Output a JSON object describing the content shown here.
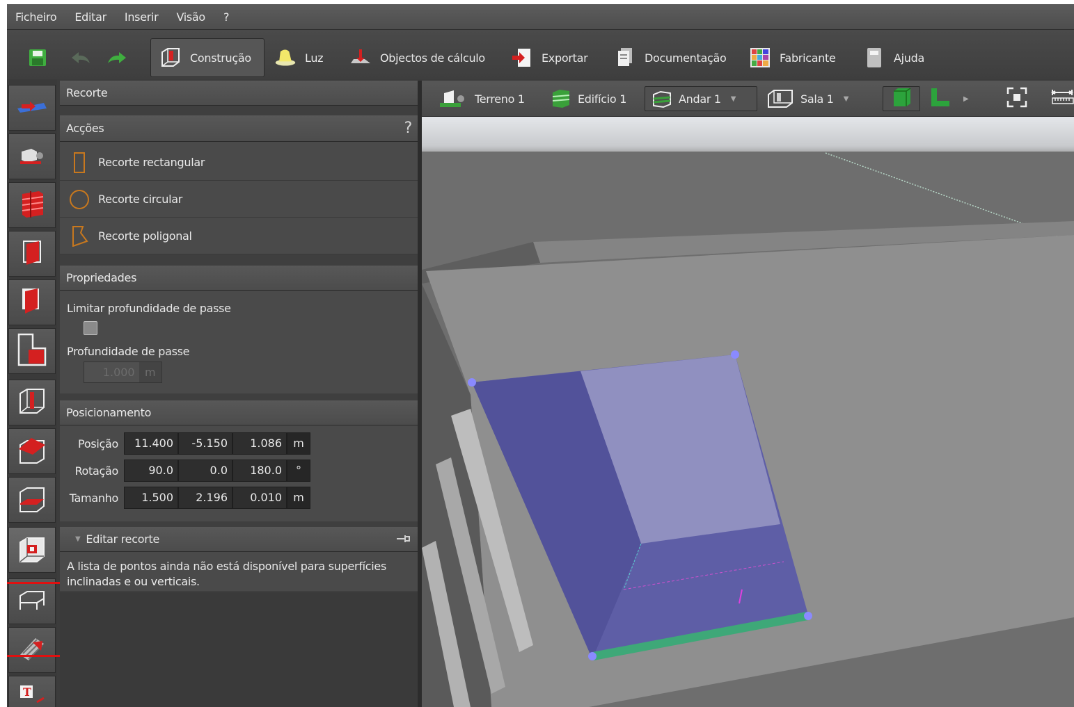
{
  "menu": {
    "items": [
      "Ficheiro",
      "Editar",
      "Inserir",
      "Visão",
      "?"
    ]
  },
  "toolbar": {
    "construcao": "Construção",
    "luz": "Luz",
    "objectos": "Objectos de cálculo",
    "exportar": "Exportar",
    "documentacao": "Documentação",
    "fabricante": "Fabricante",
    "ajuda": "Ajuda"
  },
  "panel": {
    "title": "Recorte",
    "actions_header": "Acções",
    "help": "?",
    "actions": [
      "Recorte rectangular",
      "Recorte circular",
      "Recorte poligonal"
    ],
    "properties_header": "Propriedades",
    "limit_depth_label": "Limitar profundidade de passe",
    "limit_depth_checked": false,
    "depth_label": "Profundidade de passe",
    "depth_value": "1.000",
    "depth_unit": "m",
    "positioning_header": "Posicionamento",
    "position": {
      "label": "Posição",
      "x": "11.400",
      "y": "-5.150",
      "z": "1.086",
      "unit": "m"
    },
    "rotation": {
      "label": "Rotação",
      "x": "90.0",
      "y": "0.0",
      "z": "180.0",
      "unit": "°"
    },
    "size": {
      "label": "Tamanho",
      "x": "1.500",
      "y": "2.196",
      "z": "0.010",
      "unit": "m"
    },
    "edit_header": "Editar recorte",
    "edit_message": "A lista de pontos ainda não está disponível para superfícies inclinadas e ou verticais."
  },
  "viewbar": {
    "terreno": "Terreno 1",
    "edificio": "Edifício 1",
    "andar": "Andar 1",
    "sala": "Sala 1"
  },
  "colors": {
    "accent_red": "#d42020",
    "selection_blue": "#5a5aa8",
    "highlight_green": "#3ea878",
    "view_green": "#2ca33c"
  }
}
